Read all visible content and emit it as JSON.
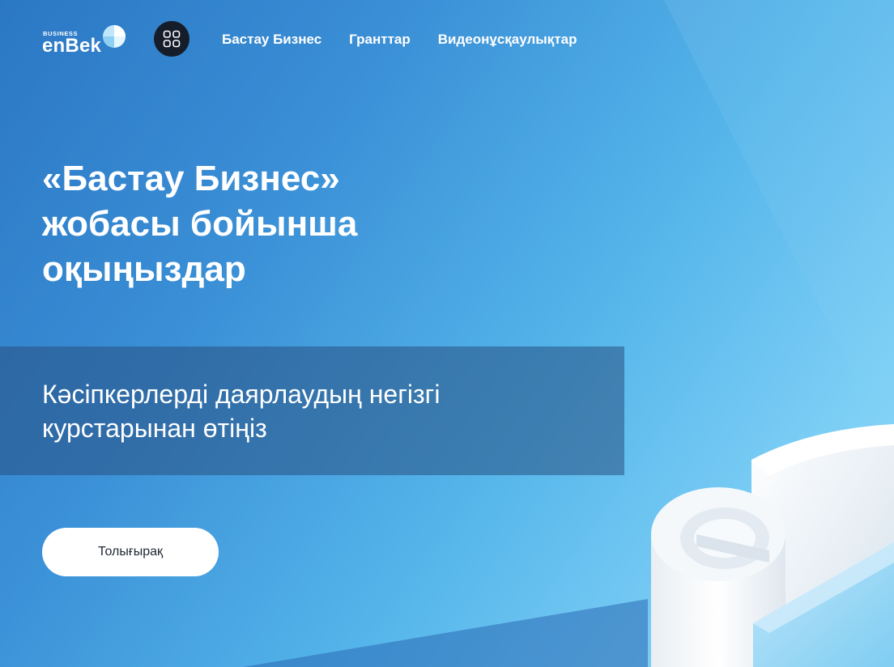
{
  "logo": {
    "small_text": "BUSINESS",
    "wordmark": "enBek",
    "icon": "enbek-logo-icon"
  },
  "header": {
    "apps_icon": "grid-apps-icon",
    "nav": [
      {
        "label": "Бастау Бизнес"
      },
      {
        "label": "Гранттар"
      },
      {
        "label": "Видеонұсқаулықтар"
      }
    ]
  },
  "hero": {
    "title_lines": [
      "«Бастау Бизнес»",
      "жобасы бойынша",
      "оқыңыздар"
    ],
    "subtitle_lines": [
      "Кәсіпкерлерді даярлаудың негізгі",
      "курстарынан өтіңіз"
    ],
    "button_label": "Толығырақ"
  },
  "colors": {
    "background_start": "#2b77c4",
    "background_end": "#8fd8f8",
    "subtitle_band": "#2c5a8a",
    "apps_button": "#161d2a",
    "button_bg": "#ffffff",
    "button_text": "#1f2633"
  },
  "decoration": {
    "icon": "3d-e-logo-illustration"
  }
}
